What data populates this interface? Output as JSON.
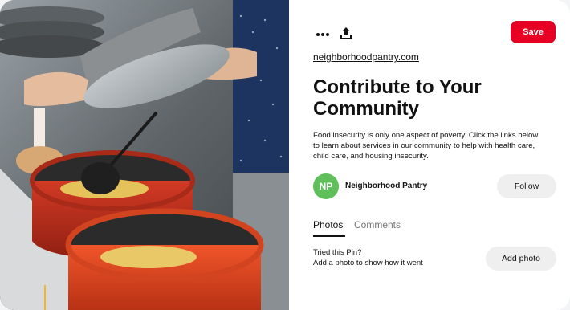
{
  "pin": {
    "image": {
      "description_icon": "photo-food-serving",
      "colors": {
        "pot_red": "#c8321e",
        "pot_orange": "#e0471f",
        "food_yellow": "#e6c35a"
      }
    },
    "toolbar": {
      "more_icon": "ellipsis-icon",
      "share_icon": "share-upload-icon",
      "save_label": "Save",
      "save_color": "#e60023"
    },
    "source_link": "neighborhoodpantry.com",
    "title": "Contribute to Your Community",
    "description": "Food insecurity is only one aspect of poverty. Click the links below to learn about services in our community to help with health care, child care, and housing insecurity.",
    "author": {
      "avatar_initials": "NP",
      "avatar_color": "#5fbf5a",
      "name": "Neighborhood Pantry",
      "follow_label": "Follow"
    },
    "tabs": [
      {
        "label": "Photos",
        "active": true
      },
      {
        "label": "Comments",
        "active": false
      }
    ],
    "tried": {
      "title": "Tried this Pin?",
      "subtitle": "Add a photo to show how it went",
      "button_label": "Add photo"
    }
  }
}
